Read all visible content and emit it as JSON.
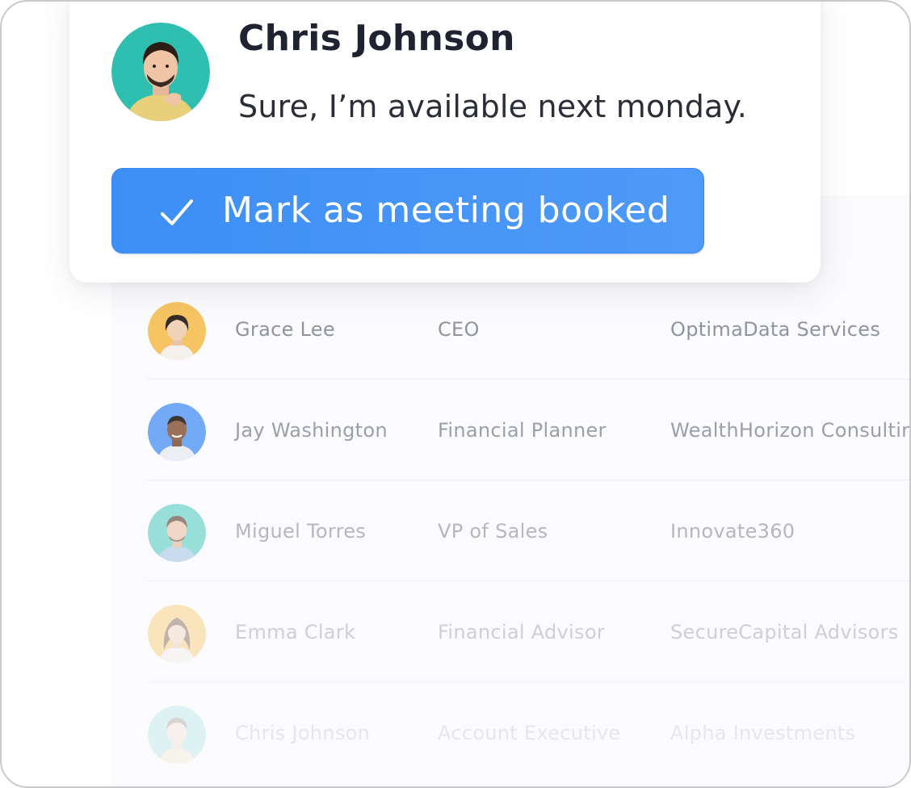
{
  "notification": {
    "sender_name": "Chris Johnson",
    "message": "Sure, I’m available next monday.",
    "action_label": "Mark as meeting booked",
    "action_icon": "check-icon",
    "accent_color": "#3d8ff6"
  },
  "contacts": [
    {
      "name": "Grace Lee",
      "title": "CEO",
      "company": "OptimaData Services",
      "avatar_color": "#f7c25b"
    },
    {
      "name": "Jay Washington",
      "title": "Financial Planner",
      "company": "WealthHorizon Consulting",
      "avatar_color": "#5b9cf7"
    },
    {
      "name": "Miguel Torres",
      "title": "VP of Sales",
      "company": "Innovate360",
      "avatar_color": "#5ccfc4"
    },
    {
      "name": "Emma Clark",
      "title": "Financial Advisor",
      "company": "SecureCapital Advisors",
      "avatar_color": "#f7c25b"
    },
    {
      "name": "Chris Johnson",
      "title": "Account Executive",
      "company": "Alpha Investments",
      "avatar_color": "#5ccfc4"
    }
  ]
}
